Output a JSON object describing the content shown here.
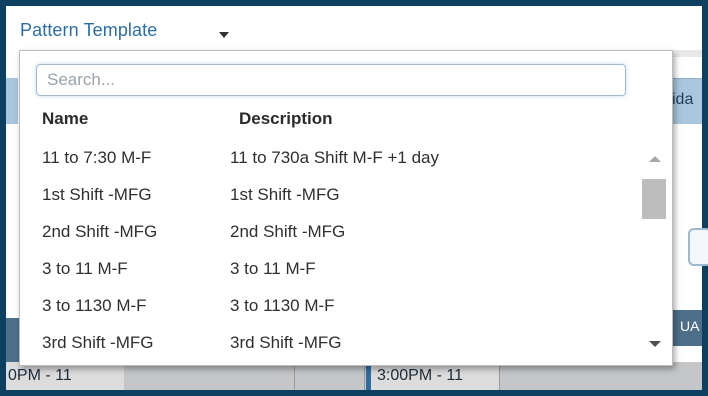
{
  "header": {
    "label": "Pattern Template",
    "caret_icon": "chevron-down-icon"
  },
  "dropdown": {
    "search_placeholder": "Search...",
    "columns": {
      "name": "Name",
      "description": "Description"
    },
    "rows": [
      {
        "name": "11 to 7:30 M-F",
        "description": "11 to 730a Shift M-F +1 day"
      },
      {
        "name": "1st Shift -MFG",
        "description": "1st Shift -MFG"
      },
      {
        "name": "2nd Shift -MFG",
        "description": "2nd Shift -MFG"
      },
      {
        "name": "3 to 11 M-F",
        "description": "3 to 11 M-F"
      },
      {
        "name": "3 to 1130 M-F",
        "description": "3 to 1130 M-F"
      },
      {
        "name": "3rd Shift -MFG",
        "description": "3rd Shift -MFG"
      }
    ]
  },
  "background": {
    "tab_fragment": "ida",
    "navy_fragment": "UA",
    "cell_left": "0PM - 11",
    "cell_mid": "3:00PM - 11"
  },
  "colors": {
    "frame": "#0c3f60",
    "accent": "#2e6da4"
  }
}
